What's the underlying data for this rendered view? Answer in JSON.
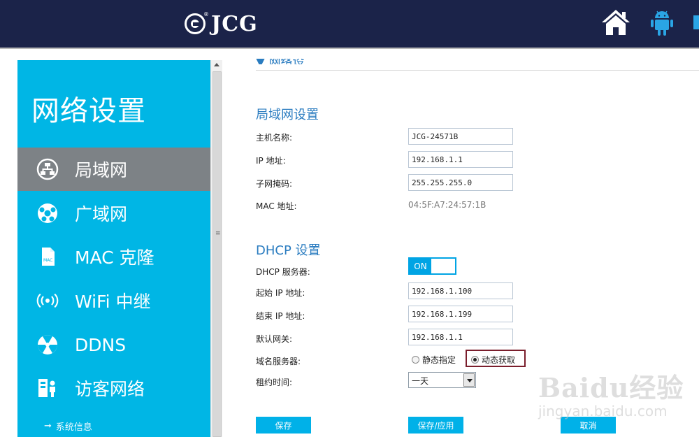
{
  "header": {
    "logo_text": "JCG",
    "logo_reg": "®",
    "icons": [
      "home-icon",
      "android-icon"
    ]
  },
  "sidebar": {
    "title": "网络设置",
    "items": [
      {
        "label": "局域网",
        "icon": "lan-icon",
        "active": true
      },
      {
        "label": "广域网",
        "icon": "wan-globe-icon",
        "active": false
      },
      {
        "label": "MAC 克隆",
        "icon": "mac-clone-icon",
        "active": false
      },
      {
        "label": "WiFi 中继",
        "icon": "wifi-relay-icon",
        "active": false
      },
      {
        "label": "DDNS",
        "icon": "ddns-icon",
        "active": false
      },
      {
        "label": "访客网络",
        "icon": "guest-network-icon",
        "active": false
      }
    ],
    "sys_info": "系统信息"
  },
  "lan": {
    "title": "局域网设置",
    "hostname_label": "主机名称:",
    "hostname_value": "JCG-24571B",
    "ip_label": "IP 地址:",
    "ip_value": "192.168.1.1",
    "mask_label": "子网掩码:",
    "mask_value": "255.255.255.0",
    "mac_label": "MAC 地址:",
    "mac_value": "04:5F:A7:24:57:1B"
  },
  "dhcp": {
    "title": "DHCP 设置",
    "server_label": "DHCP 服务器:",
    "server_state": "ON",
    "start_label": "起始 IP 地址:",
    "start_value": "192.168.1.100",
    "end_label": "结束 IP 地址:",
    "end_value": "192.168.1.199",
    "gateway_label": "默认网关:",
    "gateway_value": "192.168.1.1",
    "dns_label": "域名服务器:",
    "dns_static": "静态指定",
    "dns_dynamic": "动态获取",
    "dns_selected": "动态获取",
    "lease_label": "租约时间:",
    "lease_value": "一天"
  },
  "buttons": {
    "save": "保存",
    "save_apply": "保存/应用",
    "cancel": "取消"
  },
  "watermark": {
    "logo": "Baidu经验",
    "url": "jingyan.baidu.com"
  },
  "colors": {
    "topbar": "#1b2349",
    "sidebar": "#00b6e5",
    "active_item": "#7d8286",
    "section_title": "#2a7cc0",
    "button": "#00b1e8",
    "highlight_box": "#7a1e2c"
  }
}
